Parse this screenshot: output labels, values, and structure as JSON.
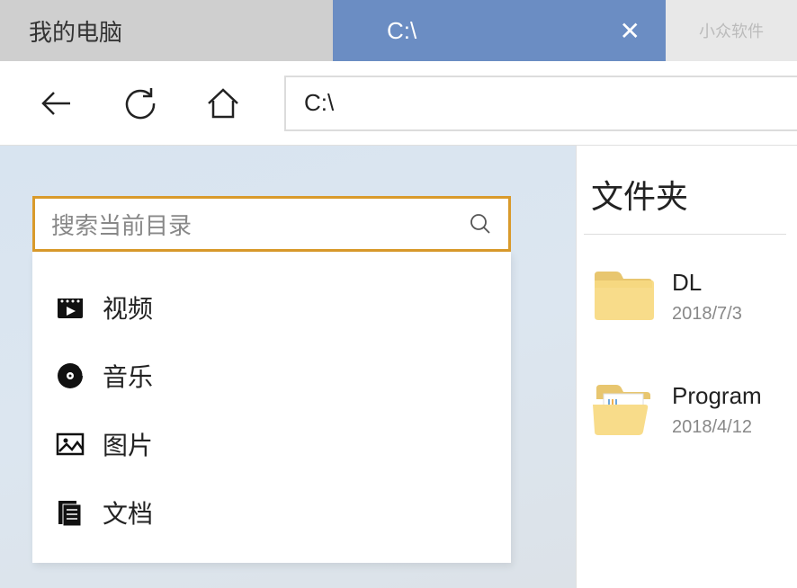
{
  "tabs": {
    "inactive": "我的电脑",
    "active": "C:\\",
    "watermark": "小众软件"
  },
  "address": "C:\\",
  "search": {
    "placeholder": "搜索当前目录"
  },
  "categories": [
    {
      "label": "视频",
      "icon": "video"
    },
    {
      "label": "音乐",
      "icon": "music"
    },
    {
      "label": "图片",
      "icon": "picture"
    },
    {
      "label": "文档",
      "icon": "document"
    }
  ],
  "section_title": "文件夹",
  "folders": [
    {
      "name": "DL",
      "date": "2018/7/3",
      "type": "folder"
    },
    {
      "name": "Program",
      "date": "2018/4/12",
      "type": "folder-open"
    }
  ]
}
